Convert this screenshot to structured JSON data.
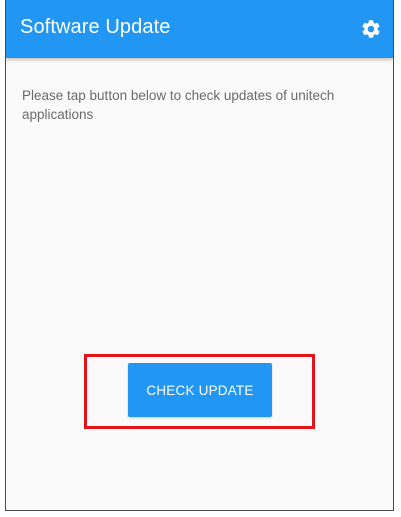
{
  "app_bar": {
    "title": "Software Update",
    "settings_icon": "gear-icon",
    "color": "#2196f3"
  },
  "content": {
    "message": "Please tap button below to check updates of unitech applications"
  },
  "actions": {
    "check_update_label": "CHECK UPDATE",
    "button_color": "#2196f3",
    "highlight_color": "#e3121b"
  }
}
